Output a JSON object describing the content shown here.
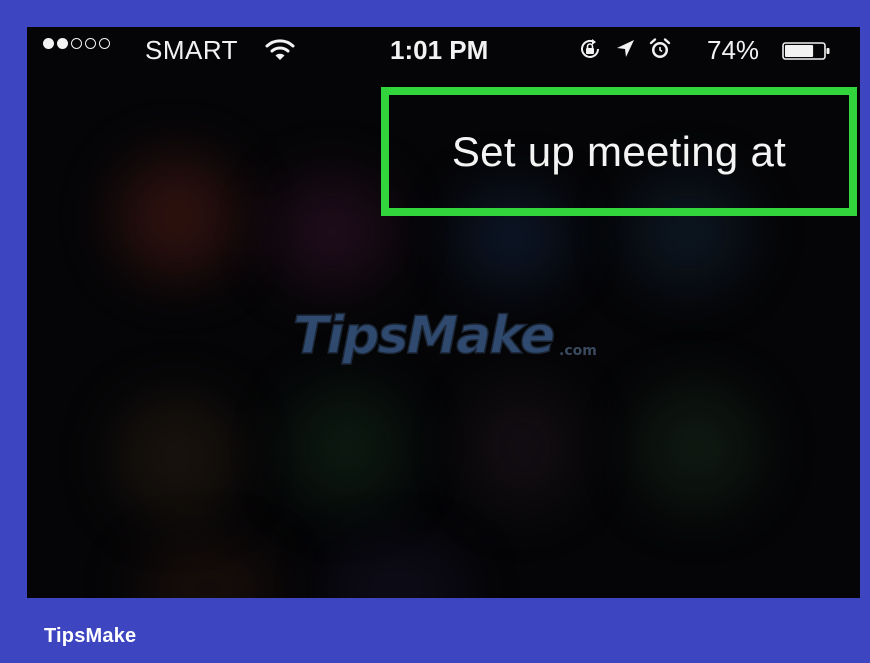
{
  "status_bar": {
    "carrier": "SMART",
    "time": "1:01 PM",
    "battery_percent": "74%",
    "battery_level": 0.74,
    "signal": {
      "filled": 2,
      "total": 5
    },
    "icons": [
      "wifi-icon",
      "rotation-lock-icon",
      "location-arrow-icon",
      "alarm-icon",
      "battery-icon"
    ]
  },
  "siri": {
    "speech_text": "Set up meeting at"
  },
  "highlight_color": "#33d53d",
  "frame_color": "#3e45c0",
  "watermark": {
    "text_main": "TipsMake",
    "text_suffix": ".com"
  },
  "footer": {
    "brand": "TipsMake"
  }
}
